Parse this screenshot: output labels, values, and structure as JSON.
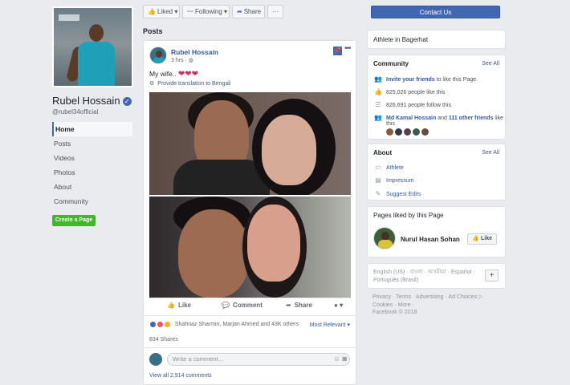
{
  "profile": {
    "name": "Rubel Hossain",
    "handle": "@rubel34official",
    "verified_symbol": "✓"
  },
  "left_nav": {
    "items": [
      {
        "label": "Home",
        "active": true
      },
      {
        "label": "Posts"
      },
      {
        "label": "Videos"
      },
      {
        "label": "Photos"
      },
      {
        "label": "About"
      },
      {
        "label": "Community"
      }
    ],
    "create_page": "Create a Page"
  },
  "action_bar": {
    "liked": "Liked",
    "following": "Following",
    "share": "Share",
    "more": "···"
  },
  "posts_label": "Posts",
  "post": {
    "author": "Rubel Hossain",
    "time": "3 hrs ·",
    "text": "My wife.. ",
    "hearts": "❤❤❤",
    "translation": "Provide translation to Bengali",
    "actions": {
      "like": "Like",
      "comment": "Comment",
      "share": "Share"
    },
    "reactors": "Shahnaz Sharmin, Marjan Ahmed and 43K others",
    "sort": "Most Relevant ▾",
    "shares": "834 Shares",
    "comment_placeholder": "Write a comment...",
    "view_comments": "View all 2,914 comments"
  },
  "right": {
    "contact": "Contact Us",
    "category": "Athlete in Bagerhat",
    "community": {
      "title": "Community",
      "see_all": "See All",
      "invite_link": "Invite your friends",
      "invite_rest": " to like this Page",
      "likes": "825,026 people like this",
      "follows": "826,691 people follow this",
      "friends_name": "Md Kamal Hossain",
      "friends_and": " and ",
      "friends_count": "111 other friends",
      "friends_rest": " like",
      "friends_wrap": "this"
    },
    "about": {
      "title": "About",
      "see_all": "See All",
      "items": [
        "Athlete",
        "Impressum",
        "Suggest Edits"
      ]
    },
    "liked_pages": {
      "title": "Pages liked by this Page",
      "name": "Nurul Hasan Sohan",
      "button": "Like"
    },
    "languages": {
      "text": "English (US) · বাংলা · অসমীয়া · Español · Português (Brasil)",
      "plus": "+"
    },
    "footer": {
      "line1": "Privacy · Terms · Advertising · Ad Choices ▷",
      "line2": "Cookies · More ·",
      "line3": "Facebook © 2018"
    }
  },
  "colors": {
    "brand": "#4267b2",
    "link": "#365899",
    "green": "#42b72a",
    "background": "#e9ebee"
  }
}
